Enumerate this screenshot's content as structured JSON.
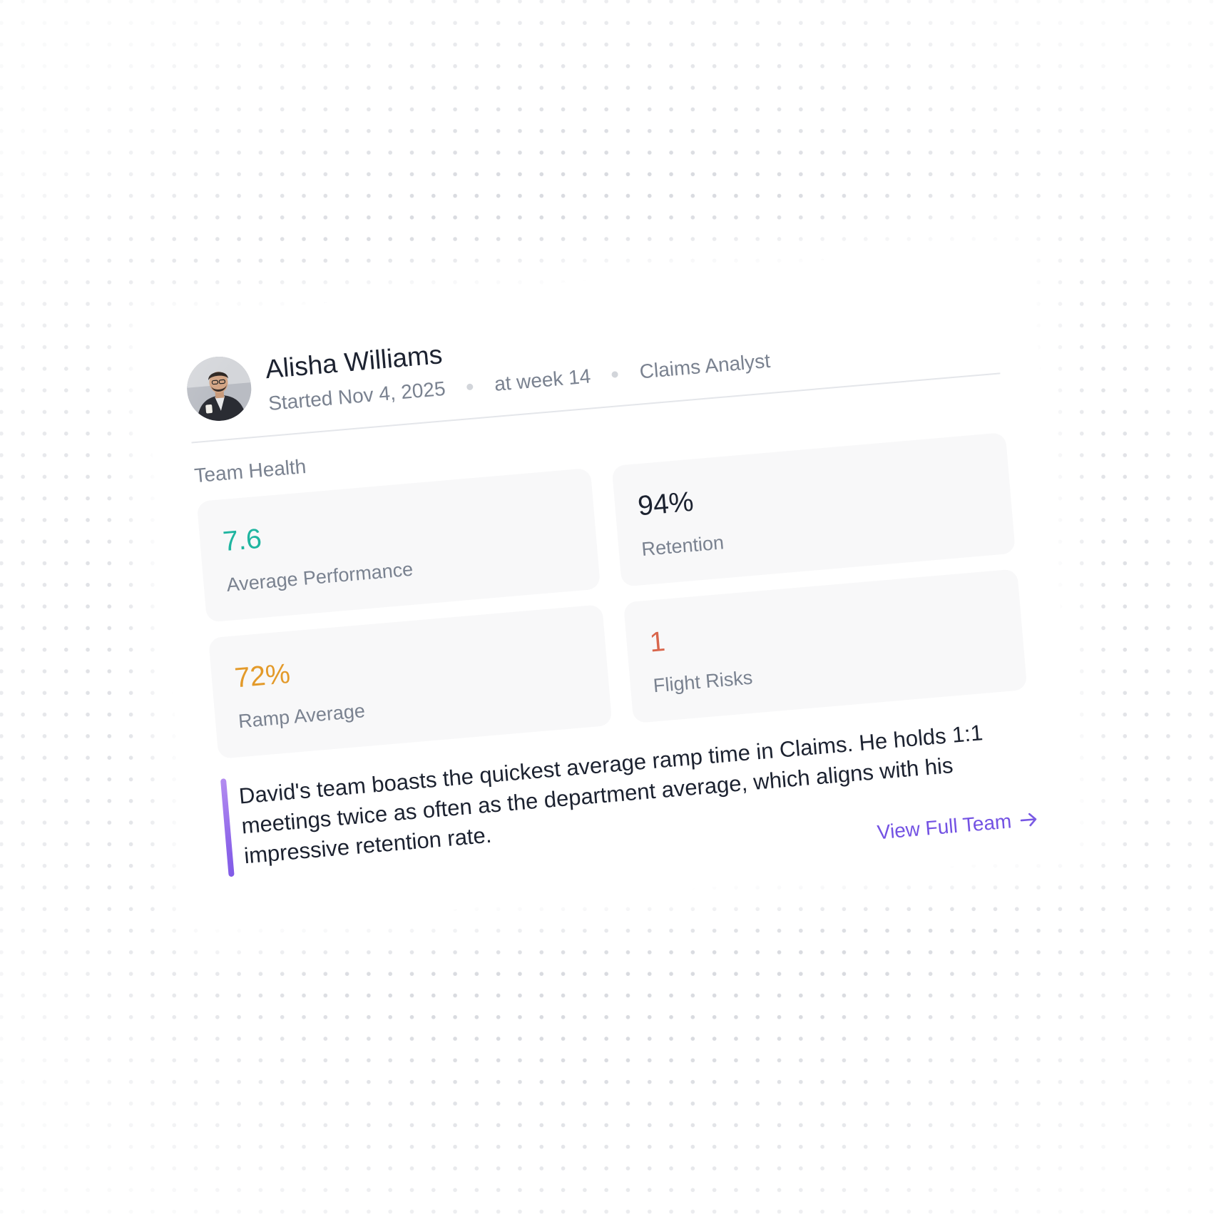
{
  "profile": {
    "name": "Alisha Williams",
    "started": "Started Nov 4, 2025",
    "week": "at week 14",
    "role": "Claims Analyst"
  },
  "section": {
    "title": "Team Health"
  },
  "metrics": [
    {
      "value": "7.6",
      "label": "Average Performance",
      "color": "#1fb5a0"
    },
    {
      "value": "94%",
      "label": "Retention",
      "color": "#1c2230"
    },
    {
      "value": "72%",
      "label": "Ramp Average",
      "color": "#e39a2a"
    },
    {
      "value": "1",
      "label": "Flight Risks",
      "color": "#d9664c"
    }
  ],
  "insight": {
    "text": "David's team boasts the quickest average ramp time in Claims. He holds 1:1 meetings twice as often as the department average, which aligns with his impressive retention rate."
  },
  "footer": {
    "link_label": "View Full Team",
    "link_icon": "arrow-right-icon"
  },
  "colors": {
    "accent": "#7352e3",
    "quote_bar_top": "#b48cf0",
    "quote_bar_bottom": "#7c55e6"
  }
}
